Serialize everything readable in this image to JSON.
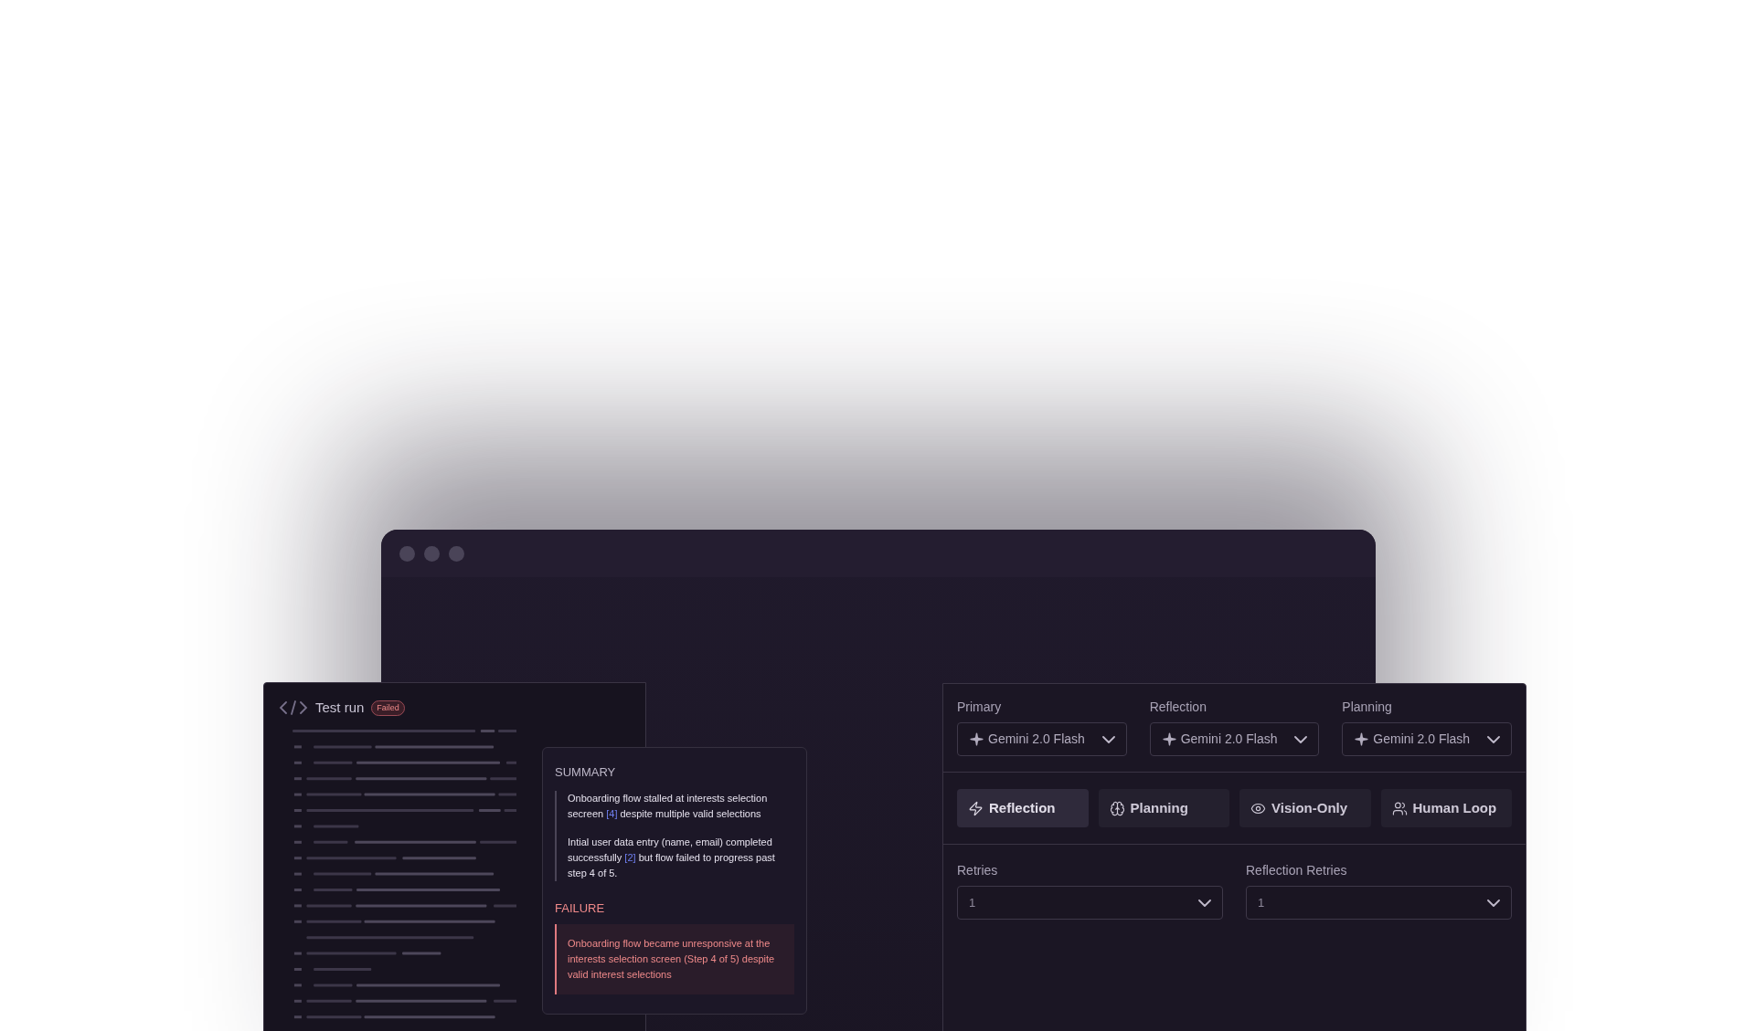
{
  "test_run": {
    "title": "Test run",
    "status": "Failed"
  },
  "summary": {
    "heading": "SUMMARY",
    "paragraphs": [
      [
        {
          "kind": "text",
          "text": "Onboarding flow stalled at interests selection secreen "
        },
        {
          "kind": "ref",
          "text": "[4]"
        },
        {
          "kind": "text",
          "text": " despite multiple valid selections"
        }
      ],
      [
        {
          "kind": "text",
          "text": "Intial user data entry (name, email) completed successfully "
        },
        {
          "kind": "ref",
          "text": "[2]"
        },
        {
          "kind": "text",
          "text": " but flow failed to progress past step 4 of 5."
        }
      ]
    ]
  },
  "failure": {
    "heading": "FAILURE",
    "text": "Onboarding flow became unresponsive at the interests selection screen (Step 4 of 5) despite valid interest selections"
  },
  "models": [
    {
      "label": "Primary",
      "value": "Gemini 2.0 Flash"
    },
    {
      "label": "Reflection",
      "value": "Gemini 2.0 Flash"
    },
    {
      "label": "Planning",
      "value": "Gemini 2.0 Flash"
    }
  ],
  "modes": [
    {
      "label": "Reflection",
      "selected": true
    },
    {
      "label": "Planning",
      "selected": false
    },
    {
      "label": "Vision-Only",
      "selected": false
    },
    {
      "label": "Human Loop",
      "selected": false
    }
  ],
  "retries": [
    {
      "label": "Retries",
      "value": "1"
    },
    {
      "label": "Reflection Retries",
      "value": "1"
    }
  ]
}
